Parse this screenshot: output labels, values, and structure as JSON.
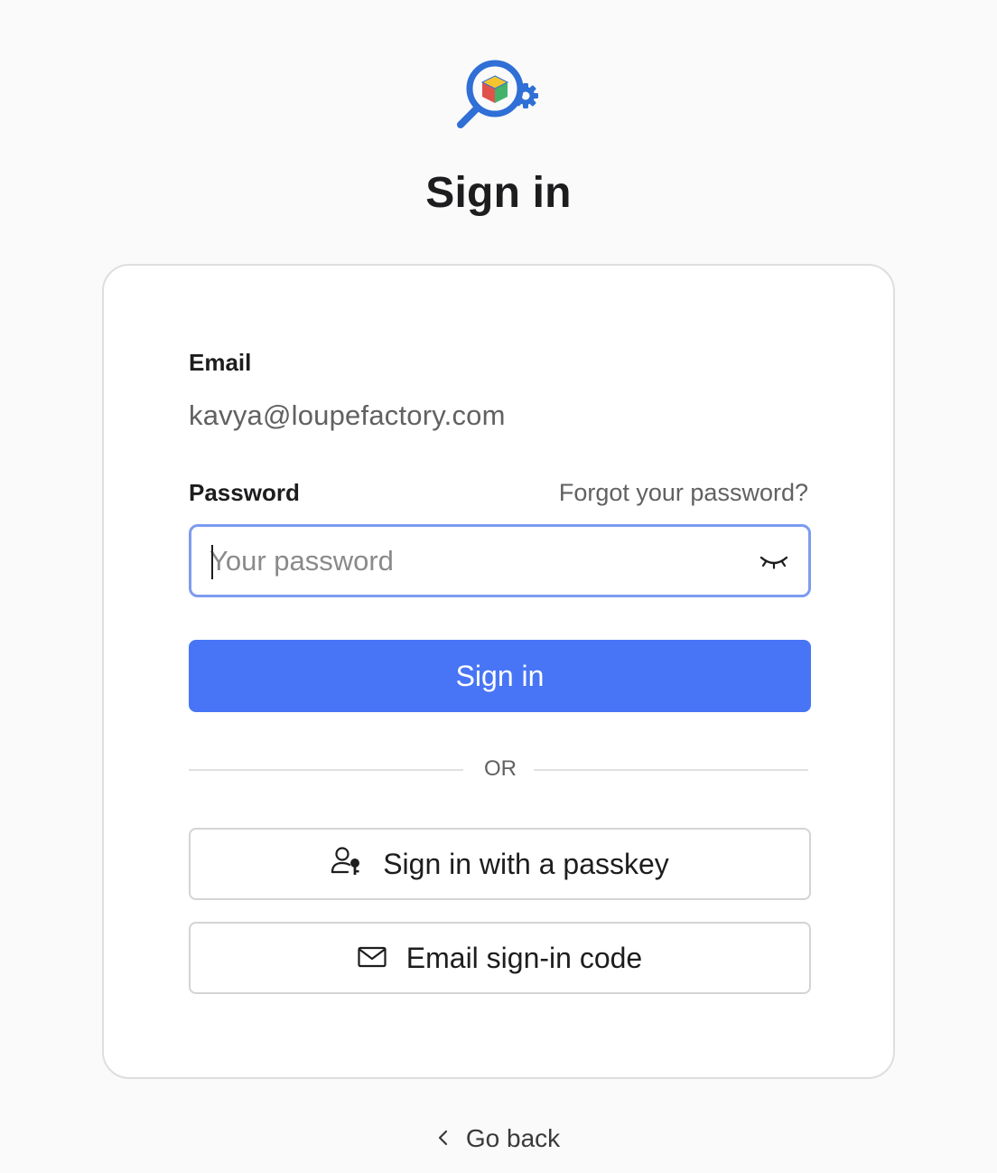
{
  "brand": {
    "logo_icon": "loupe-cube-gear-logo",
    "accent": "#2f6fd6"
  },
  "header": {
    "title": "Sign in"
  },
  "form": {
    "email_label": "Email",
    "email_value": "kavya@loupefactory.com",
    "password_label": "Password",
    "forgot_link": "Forgot your password?",
    "password_placeholder": "Your password",
    "password_value": "",
    "password_toggle_icon": "eye-closed-icon",
    "submit_label": "Sign in",
    "submit_color": "#4775f5"
  },
  "divider": {
    "text": "OR"
  },
  "alternatives": {
    "passkey_label": "Sign in with a passkey",
    "passkey_icon": "user-key-icon",
    "email_code_label": "Email sign-in code",
    "email_code_icon": "envelope-icon"
  },
  "footer": {
    "back_label": "Go back",
    "back_icon": "chevron-left-icon"
  }
}
